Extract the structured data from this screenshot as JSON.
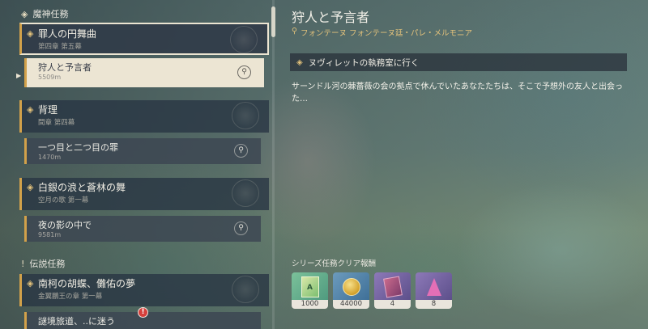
{
  "left": {
    "section1": {
      "title": "魔神任務",
      "icon": "quest-diamond-icon"
    },
    "chapters": [
      {
        "title": "罪人の円舞曲",
        "subtitle": "第四章 第五幕"
      },
      {
        "title": "背理",
        "subtitle": "間章 第四幕"
      },
      {
        "title": "白銀の浪と蒼林の舞",
        "subtitle": "空月の歌 第一幕"
      },
      {
        "title": "南柯の胡蝶、儺佑の夢",
        "subtitle": "金翼鵬王の章 第一幕"
      }
    ],
    "quests": [
      {
        "title": "狩人と予言者",
        "distance": "5509m"
      },
      {
        "title": "一つ目と二つ目の罪",
        "distance": "1470m"
      },
      {
        "title": "夜の影の中で",
        "distance": "9581m"
      },
      {
        "title": "謎境旅道、..に迷う",
        "distance": ""
      }
    ],
    "section2": {
      "title": "伝説任務",
      "icon": "exclamation-icon"
    }
  },
  "right": {
    "title": "狩人と予言者",
    "location": "フォンテーヌ フォンテーヌ廷・パレ・メルモニア",
    "objective": "ヌヴィレットの執務室に行く",
    "description": "サーンドル河の棘薔薇の会の拠点で休んでいたあなたたちは、そこで予想外の友人と出会った…",
    "rewards_title": "シリーズ任務クリア報酬",
    "rewards": [
      {
        "name": "hero-wit-exp-book",
        "count": "1000"
      },
      {
        "name": "mora-coin",
        "count": "44000"
      },
      {
        "name": "talent-book",
        "count": "4"
      },
      {
        "name": "ascension-crystal",
        "count": "8"
      }
    ]
  }
}
